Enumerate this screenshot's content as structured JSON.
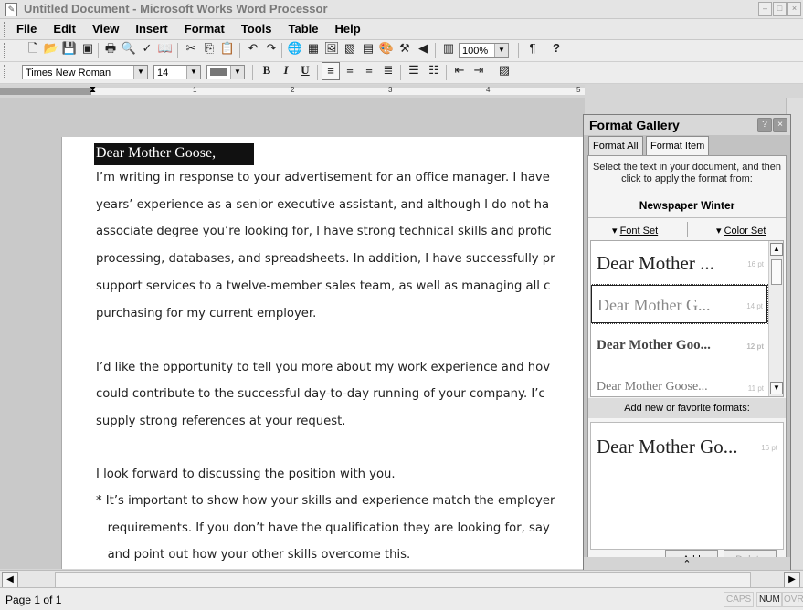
{
  "window": {
    "title": "Untitled Document - Microsoft Works Word Processor"
  },
  "menu": [
    "File",
    "Edit",
    "View",
    "Insert",
    "Format",
    "Tools",
    "Table",
    "Help"
  ],
  "toolbar": {
    "zoom": "100%",
    "font_name": "Times New Roman",
    "font_size": "14"
  },
  "ruler": {
    "marks": [
      "1",
      "2",
      "3",
      "4",
      "5"
    ]
  },
  "document": {
    "salutation": "Dear Mother Goose,",
    "lines": [
      "I’m writing in response to your advertisement for an office manager. I have",
      "years’ experience as a senior executive assistant, and although I do not ha",
      "associate degree you’re looking for, I have strong technical skills and profic",
      "processing, databases, and spreadsheets. In addition, I have successfully pr",
      "support services to a twelve-member sales team, as well as managing all c",
      "purchasing for my current employer.",
      "",
      "I’d like the opportunity to tell you more about my work experience and hov",
      "could contribute to the successful day-to-day running of your company. I’c",
      "supply strong references at your request.",
      "",
      "I look forward to discussing the position with you.",
      "* It’s important to show how your skills and experience match the employer",
      "   requirements. If you don’t have the qualification they are looking for, say",
      "   and point out how your other skills overcome this."
    ]
  },
  "format_gallery": {
    "title": "Format Gallery",
    "tabs": [
      "Format All",
      "Format Item"
    ],
    "instruction": "Select the text in your document, and then click to apply the format from:",
    "set_name": "Newspaper Winter",
    "font_set_label": "Font Set",
    "color_set_label": "Color Set",
    "items": [
      {
        "text": "Dear Mother ...",
        "size": "16 pt"
      },
      {
        "text": "Dear Mother G...",
        "size": "14 pt"
      },
      {
        "text": "Dear Mother Goo...",
        "size": "12 pt"
      },
      {
        "text": "Dear Mother Goose...",
        "size": "11 pt"
      }
    ],
    "favorites_label": "Add new or favorite formats:",
    "favorite_item": {
      "text": "Dear Mother Go...",
      "size": "16 pt"
    },
    "add_label": "Add",
    "delete_label": "Delete"
  },
  "status": {
    "page": "Page 1 of 1",
    "caps": "CAPS",
    "num": "NUM",
    "ovr": "OVR"
  }
}
